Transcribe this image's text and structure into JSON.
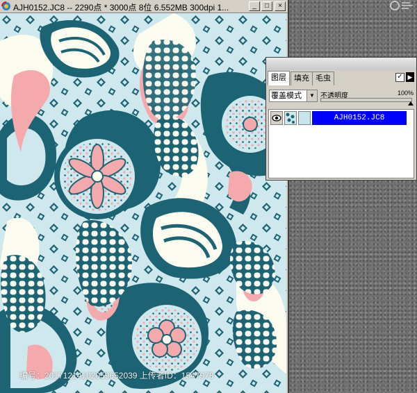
{
  "window": {
    "title": "AJH0152.JC8 -- 2290点 * 3000点 8位   6.552MB 300dpi 1...",
    "buttons": {
      "minimize": "_",
      "maximize": "□",
      "close": "×"
    }
  },
  "layers_panel": {
    "tabs": [
      "图层",
      "填充",
      "毛虫"
    ],
    "active_tab": 0,
    "checkbox": "✓",
    "menu_arrow": "▶",
    "blend_mode": "覆盖模式",
    "opacity_label": "不透明度",
    "opacity_value": "100%",
    "opacity_level": 1.0,
    "layer_name": "AJH0152.JC8"
  },
  "watermark": "编号：20171214102059652039 上传者ID：1547978",
  "colors": {
    "canvas_bg": "#cfe8ee",
    "teal": "#1c6474",
    "pink": "#f4a9ad",
    "cream": "#fbfbef",
    "selection_blue": "#0000ff"
  },
  "icons": {
    "app": "app-logo-icon",
    "eye": "eye-icon",
    "layer_thumb": "pattern-thumbnail-icon",
    "site": "site-logo-icon"
  }
}
